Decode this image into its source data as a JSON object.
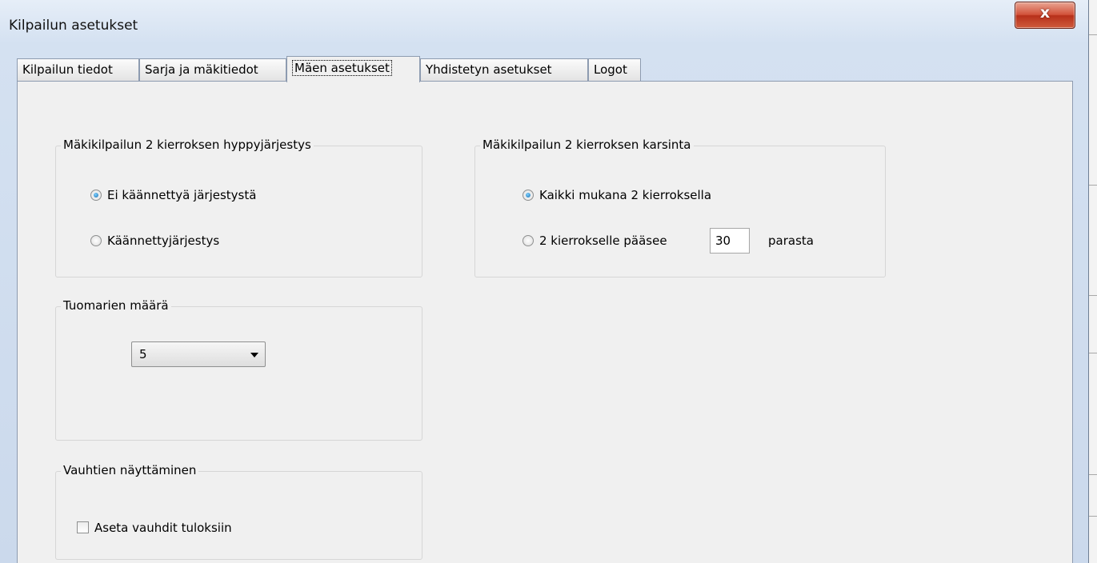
{
  "window": {
    "title": "Kilpailun asetukset",
    "close_glyph": "x"
  },
  "tabs": [
    {
      "label": "Kilpailun tiedot"
    },
    {
      "label": "Sarja ja mäkitiedot"
    },
    {
      "label": "Mäen asetukset",
      "active": true
    },
    {
      "label": "Yhdistetyn asetukset"
    },
    {
      "label": "Logot"
    }
  ],
  "order_group": {
    "title": "Mäkikilpailun 2 kierroksen hyppyjärjestys",
    "options": [
      {
        "label": "Ei käännettyä järjestystä",
        "selected": true
      },
      {
        "label": "Käännettyjärjestys",
        "selected": false
      }
    ]
  },
  "qualify_group": {
    "title": "Mäkikilpailun 2 kierroksen karsinta",
    "options": [
      {
        "label": "Kaikki mukana 2 kierroksella",
        "selected": true
      },
      {
        "label": "2 kierrokselle pääsee",
        "selected": false
      }
    ],
    "count_value": "30",
    "count_suffix": "parasta"
  },
  "judges_group": {
    "title": "Tuomarien määrä",
    "selected_value": "5"
  },
  "speeds_group": {
    "title": "Vauhtien näyttäminen",
    "checkbox_label": "Aseta vauhdit tuloksiin",
    "checked": false
  }
}
